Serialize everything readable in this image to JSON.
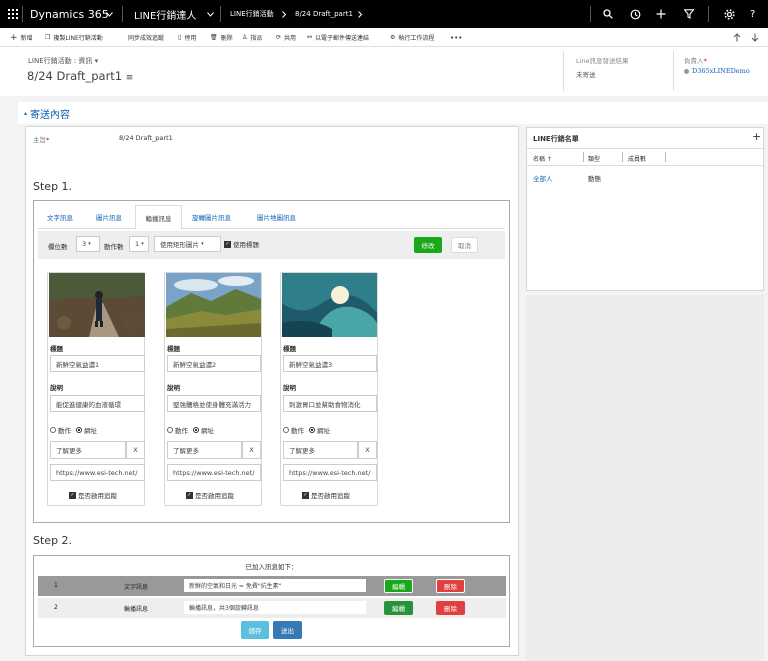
{
  "nav": {
    "app_name": "Dynamics 365",
    "module": "LINE行銷達人",
    "crumb1": "LINE行銷活動",
    "crumb2": "8/24 Draft_part1"
  },
  "cmd": {
    "new": "新增",
    "copy_line": "複製LINE行銷活動",
    "sync": "同步成效追蹤",
    "deactivate": "停用",
    "delete": "刪除",
    "assign": "指派",
    "share": "共用",
    "email_link": "以電子郵件傳送連結",
    "run_workflow": "執行工作流程",
    "more": "•••"
  },
  "header": {
    "entity_label": "LINE行銷活動 : 資訊",
    "title": "8/24 Draft_part1",
    "send_result_label": "Line訊息發送結果",
    "send_result_value": "未寄送",
    "owner_label": "負責人",
    "owner_required": "*",
    "owner_value": "D365xLINEDemo"
  },
  "section_title": "寄送內容",
  "subject": {
    "label": "主旨",
    "required": "*",
    "value": "8/24 Draft_part1"
  },
  "step1": {
    "title": "Step 1.",
    "tabs": [
      "文字訊息",
      "圖片訊息",
      "輪播訊息",
      "旋轉圖片訊息",
      "圖片地圖訊息"
    ],
    "active_tab": "輪播訊息",
    "controls": {
      "col_label": "欄位數",
      "col_value": "3",
      "action_label": "動作數",
      "action_value": "1",
      "image_mode": "使用矩形圖片",
      "use_title": "使用標題",
      "edit": "修改",
      "cancel": "取消"
    },
    "cards": [
      {
        "title_label": "標題",
        "title": "新鮮空氣益濃1",
        "desc_label": "說明",
        "desc": "能促進健康的血液循環",
        "action_opt": "動作",
        "url_opt": "網址",
        "link_text": "了解更多",
        "clear": "X",
        "url": "https://www.esi-tech.net/",
        "track": "是否啟用追蹤"
      },
      {
        "title_label": "標題",
        "title": "新鮮空氣益濃2",
        "desc_label": "說明",
        "desc": "堅強體格並使身體充滿活力",
        "action_opt": "動作",
        "url_opt": "網址",
        "link_text": "了解更多",
        "clear": "X",
        "url": "https://www.esi-tech.net/",
        "track": "是否啟用追蹤"
      },
      {
        "title_label": "標題",
        "title": "新鮮空氣益濃3",
        "desc_label": "說明",
        "desc": "刺激胃口並幫助食物消化",
        "action_opt": "動作",
        "url_opt": "網址",
        "link_text": "了解更多",
        "clear": "X",
        "url": "https://www.esi-tech.net/",
        "track": "是否啟用追蹤"
      }
    ]
  },
  "step2": {
    "title": "Step 2.",
    "caption": "已加入訊息如下：",
    "rows": [
      {
        "no": "1",
        "type": "文字訊息",
        "content": "新鮮的空氣和日光 = 免費\"抗生素\"",
        "edit": "編輯",
        "delete": "刪除"
      },
      {
        "no": "2",
        "type": "輪播訊息",
        "content": "輪播訊息，共3個旋轉訊息",
        "edit": "編輯",
        "delete": "刪除"
      }
    ],
    "save": "儲存",
    "send": "送出"
  },
  "sidebar": {
    "title": "LINE行銷名單",
    "add": "+",
    "col_name": "名稱 ↑",
    "col_type": "類型",
    "col_count": "成員數",
    "row_name": "全部人",
    "row_type": "動態"
  },
  "colors": {
    "nav_bg": "#000000",
    "link": "#1160b7",
    "green": "#19a819",
    "red": "#e04040",
    "save_btn": "#5bc0de",
    "send_btn": "#337ab7"
  }
}
